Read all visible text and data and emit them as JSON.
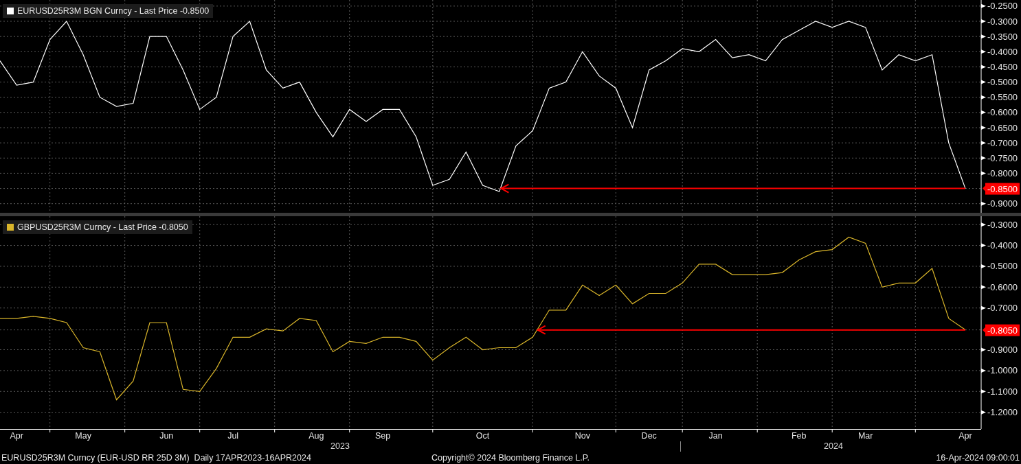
{
  "panels": [
    {
      "legend_detail": "- Last Price -0.8500",
      "chart_data": {
        "type": "line",
        "grid": true,
        "series": [
          {
            "name": "EURUSD25R3M BGN Curncy",
            "color": "#ffffff",
            "values": [
              -0.43,
              -0.51,
              -0.5,
              -0.36,
              -0.3,
              -0.41,
              -0.55,
              -0.58,
              -0.57,
              -0.35,
              -0.35,
              -0.46,
              -0.59,
              -0.55,
              -0.35,
              -0.3,
              -0.46,
              -0.52,
              -0.5,
              -0.6,
              -0.68,
              -0.59,
              -0.63,
              -0.59,
              -0.59,
              -0.68,
              -0.84,
              -0.82,
              -0.73,
              -0.84,
              -0.86,
              -0.71,
              -0.66,
              -0.52,
              -0.5,
              -0.4,
              -0.48,
              -0.52,
              -0.65,
              -0.46,
              -0.43,
              -0.39,
              -0.4,
              -0.36,
              -0.42,
              -0.41,
              -0.43,
              -0.36,
              -0.33,
              -0.3,
              -0.32,
              -0.3,
              -0.32,
              -0.46,
              -0.41,
              -0.43,
              -0.41,
              -0.7,
              -0.85
            ]
          }
        ],
        "ylim": [
          -0.93,
          -0.23
        ],
        "yticks": [
          {
            "value": -0.25,
            "label": "-0.2500"
          },
          {
            "value": -0.3,
            "label": "-0.3000"
          },
          {
            "value": -0.35,
            "label": "-0.3500"
          },
          {
            "value": -0.4,
            "label": "-0.4000"
          },
          {
            "value": -0.45,
            "label": "-0.4500"
          },
          {
            "value": -0.5,
            "label": "-0.5000"
          },
          {
            "value": -0.55,
            "label": "-0.5500"
          },
          {
            "value": -0.6,
            "label": "-0.6000"
          },
          {
            "value": -0.65,
            "label": "-0.6500"
          },
          {
            "value": -0.7,
            "label": "-0.7000"
          },
          {
            "value": -0.75,
            "label": "-0.7500"
          },
          {
            "value": -0.8,
            "label": "-0.8000"
          },
          {
            "value": -0.85,
            "label": "-0.8500"
          },
          {
            "value": -0.9,
            "label": "-0.9000"
          }
        ],
        "ref_lines": [
          {
            "axis": "y",
            "value": -0.85,
            "color": "#ff0000"
          }
        ]
      }
    },
    {
      "legend_detail": "- Last Price -0.8050",
      "chart_data": {
        "type": "line",
        "grid": true,
        "categories": [
          null,
          "Apr",
          null,
          null,
          null,
          "May",
          null,
          null,
          null,
          null,
          "Jun",
          null,
          null,
          null,
          "Jul",
          null,
          null,
          null,
          null,
          "Aug",
          null,
          null,
          null,
          "Sep",
          null,
          null,
          null,
          null,
          null,
          "Oct",
          null,
          null,
          null,
          null,
          null,
          "Nov",
          null,
          null,
          null,
          "Dec",
          null,
          null,
          null,
          "Jan",
          null,
          null,
          null,
          null,
          "Feb",
          null,
          null,
          null,
          "Mar",
          null,
          null,
          null,
          null,
          null,
          "Apr"
        ],
        "series": [
          {
            "name": "GBPUSD25R3M Curncy",
            "color": "#d9b52a",
            "values": [
              -0.75,
              -0.75,
              -0.74,
              -0.75,
              -0.77,
              -0.89,
              -0.91,
              -1.14,
              -1.05,
              -0.77,
              -0.77,
              -1.09,
              -1.1,
              -0.99,
              -0.84,
              -0.84,
              -0.8,
              -0.81,
              -0.75,
              -0.76,
              -0.91,
              -0.86,
              -0.87,
              -0.84,
              -0.84,
              -0.86,
              -0.95,
              -0.89,
              -0.84,
              -0.9,
              -0.89,
              -0.89,
              -0.84,
              -0.71,
              -0.71,
              -0.59,
              -0.64,
              -0.59,
              -0.68,
              -0.63,
              -0.63,
              -0.58,
              -0.49,
              -0.49,
              -0.54,
              -0.54,
              -0.54,
              -0.53,
              -0.47,
              -0.43,
              -0.42,
              -0.36,
              -0.39,
              -0.6,
              -0.58,
              -0.58,
              -0.51,
              -0.75,
              -0.805
            ]
          }
        ],
        "ylim": [
          -1.28,
          -0.26
        ],
        "yticks": [
          {
            "value": -0.3,
            "label": "-0.3000"
          },
          {
            "value": -0.4,
            "label": "-0.4000"
          },
          {
            "value": -0.5,
            "label": "-0.5000"
          },
          {
            "value": -0.6,
            "label": "-0.6000"
          },
          {
            "value": -0.7,
            "label": "-0.7000"
          },
          {
            "value": -0.805,
            "label": "-0.8050"
          },
          {
            "value": -0.9,
            "label": "-0.9000"
          },
          {
            "value": -1.0,
            "label": "-1.0000"
          },
          {
            "value": -1.1,
            "label": "-1.1000"
          },
          {
            "value": -1.2,
            "label": "-1.2000"
          }
        ],
        "ref_lines": [
          {
            "axis": "y",
            "value": -0.805,
            "color": "#ff0000"
          }
        ]
      }
    }
  ],
  "years": [
    "2023",
    "2024"
  ],
  "footer": {
    "left": "EURUSD25R3M Curncy (EUR-USD RR 25D 3M)  Daily 17APR2023-16APR2024",
    "center": "Copyright© 2024 Bloomberg Finance L.P.",
    "right": "16-Apr-2024 09:00:01"
  }
}
